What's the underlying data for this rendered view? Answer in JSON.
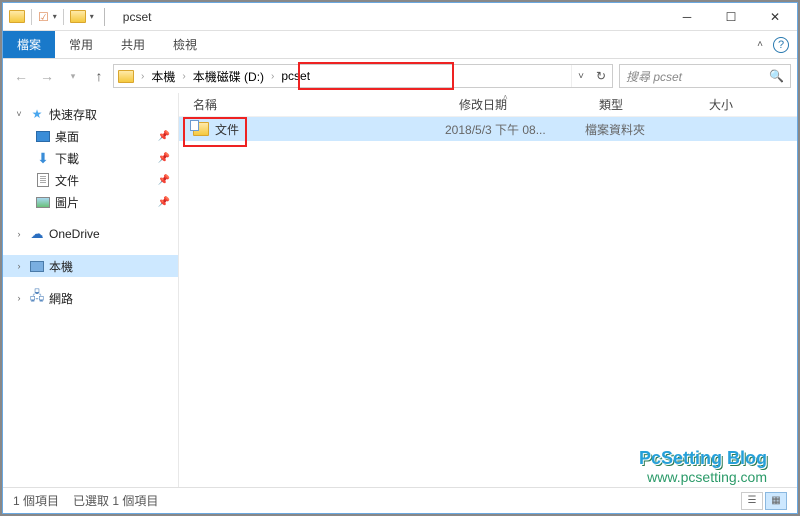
{
  "title": "pcset",
  "ribbon": {
    "file": "檔案",
    "tabs": [
      "常用",
      "共用",
      "檢視"
    ]
  },
  "breadcrumb": {
    "root": "本機",
    "parts": [
      "本機磁碟 (D:)",
      "pcset"
    ]
  },
  "search": {
    "placeholder": "搜尋 pcset"
  },
  "tree": {
    "quick": "快速存取",
    "desktop": "桌面",
    "downloads": "下載",
    "documents": "文件",
    "pictures": "圖片",
    "onedrive": "OneDrive",
    "thispc": "本機",
    "network": "網路"
  },
  "columns": {
    "name": "名稱",
    "date": "修改日期",
    "type": "類型",
    "size": "大小"
  },
  "files": [
    {
      "name": "文件",
      "date": "2018/5/3 下午 08...",
      "type": "檔案資料夾",
      "size": ""
    }
  ],
  "status": {
    "count": "1 個項目",
    "selected": "已選取 1 個項目"
  },
  "watermark": {
    "line1": "PcSetting Blog",
    "line2": "www.pcsetting.com"
  }
}
